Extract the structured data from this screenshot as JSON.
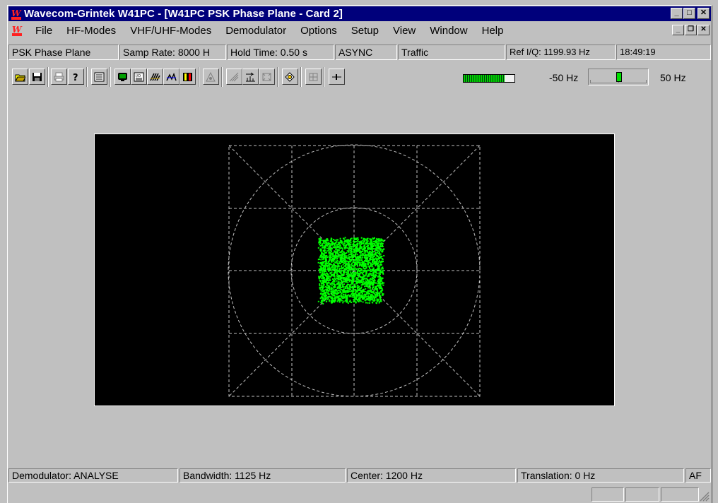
{
  "window": {
    "title": "Wavecom-Grintek W41PC - [W41PC PSK Phase Plane  - Card 2]",
    "caption_buttons": {
      "minimize": "_",
      "maximize": "□",
      "close": "✕"
    },
    "mdi_buttons": {
      "minimize": "_",
      "restore": "❐",
      "close": "✕"
    }
  },
  "menu": {
    "items": [
      {
        "label": "File"
      },
      {
        "label": "HF-Modes"
      },
      {
        "label": "VHF/UHF-Modes"
      },
      {
        "label": "Demodulator"
      },
      {
        "label": "Options"
      },
      {
        "label": "Setup"
      },
      {
        "label": "View"
      },
      {
        "label": "Window"
      },
      {
        "label": "Help"
      }
    ]
  },
  "info": {
    "mode": "PSK Phase Plane",
    "samp_rate": "Samp Rate: 8000 H",
    "hold_time": "Hold Time: 0.50 s",
    "sync": "ASYNC",
    "traffic": "Traffic",
    "ref_iq": "Ref I/Q: 1199.93 Hz",
    "clock": "18:49:19"
  },
  "toolbar": {
    "buttons": [
      {
        "icon": "open-folder-icon"
      },
      {
        "icon": "save-disk-icon"
      },
      {
        "icon": "print-icon"
      },
      {
        "icon": "help-icon"
      },
      {
        "icon": "table-view-icon"
      },
      {
        "icon": "monitor-icon"
      },
      {
        "icon": "io-panel-icon"
      },
      {
        "icon": "waveform-icon"
      },
      {
        "icon": "spectrum-icon"
      },
      {
        "icon": "waterfall-icon"
      },
      {
        "icon": "scope-icon"
      },
      {
        "icon": "analyser-icon"
      },
      {
        "icon": "signal-import-icon"
      },
      {
        "icon": "signal-export-icon"
      },
      {
        "icon": "target-icon"
      },
      {
        "icon": "grid-icon"
      },
      {
        "icon": "center-tuning-icon"
      }
    ],
    "level_fraction": 0.8,
    "tune_min_label": "-50 Hz",
    "tune_max_label": "50 Hz",
    "tune_offset_hz": 0
  },
  "phase_plane": {
    "background": "#000000",
    "grid_color": "#c0c0c0",
    "cluster_color": "#00ff00"
  },
  "status": {
    "demodulator": "Demodulator: ANALYSE",
    "bandwidth": "Bandwidth: 1125 Hz",
    "center": "Center: 1200 Hz",
    "translation": "Translation: 0 Hz",
    "af": "AF"
  }
}
